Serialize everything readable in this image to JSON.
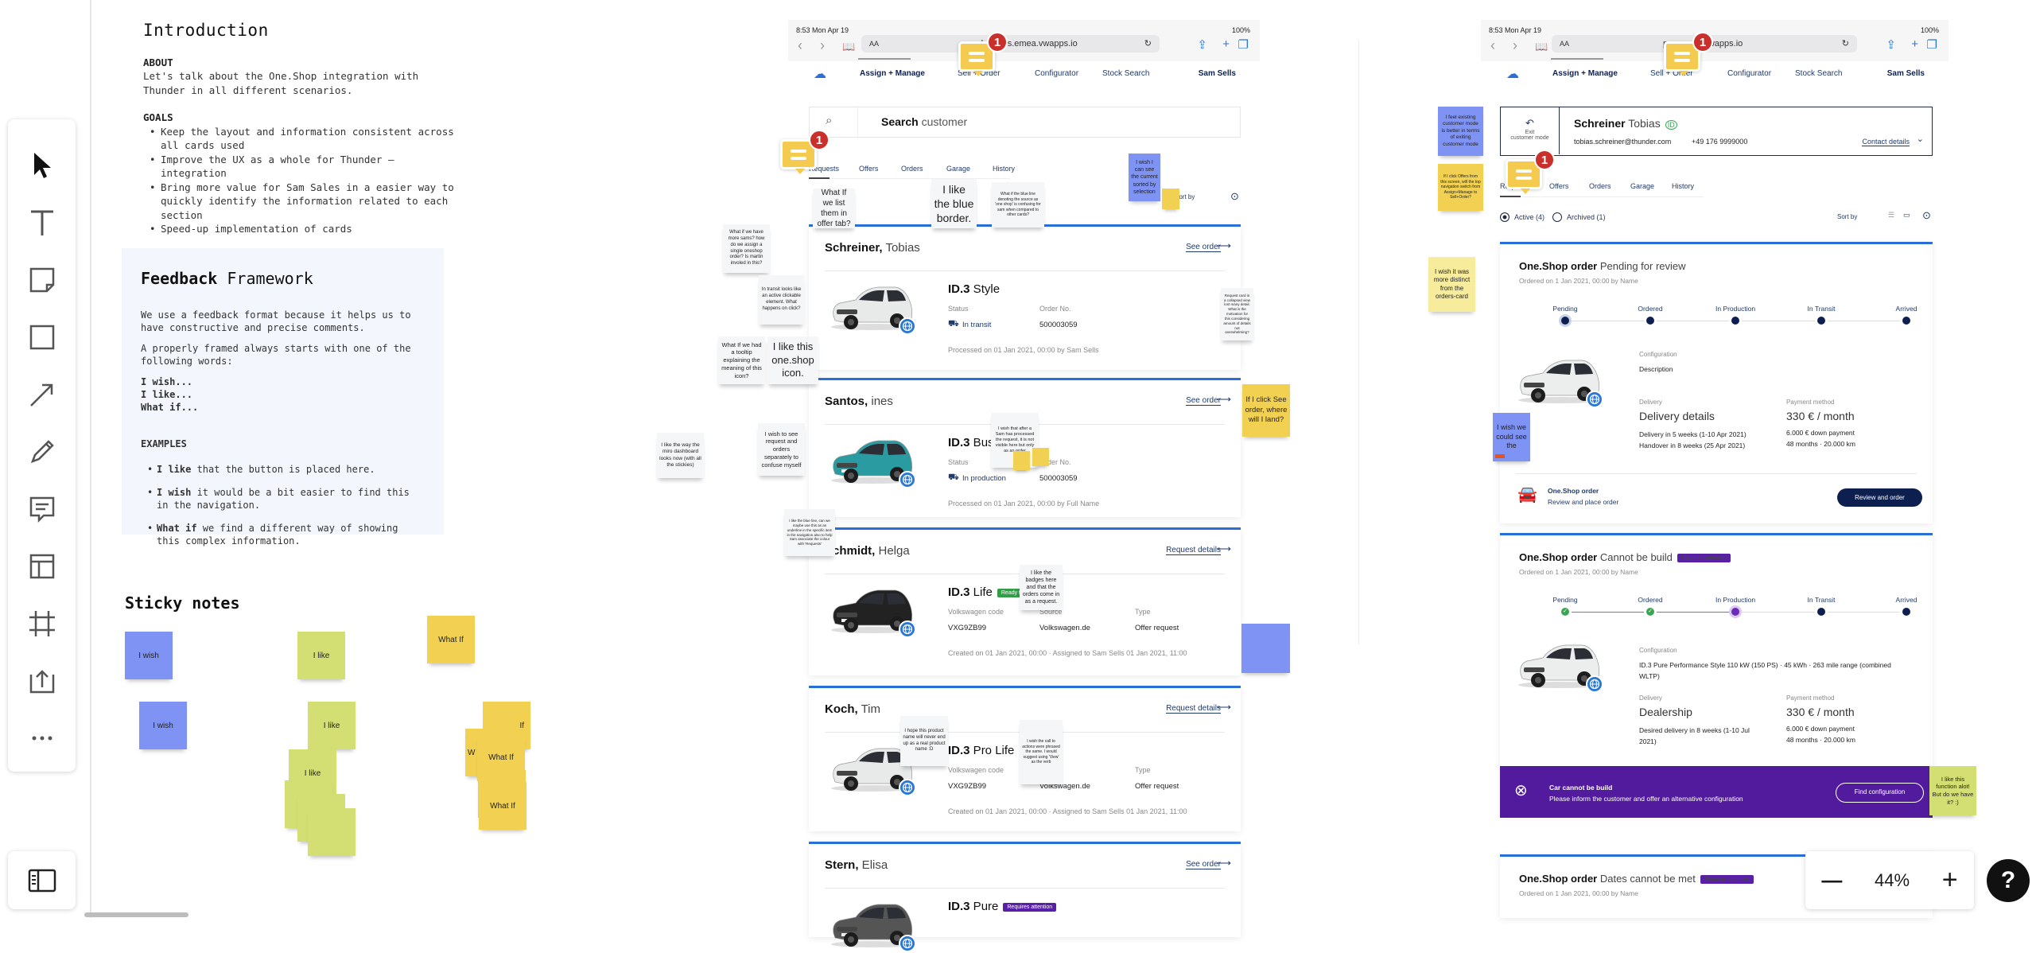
{
  "toolbar": {
    "tools": [
      "select",
      "text",
      "sticky-note",
      "shape",
      "arrow",
      "pen",
      "comment",
      "templates",
      "frame",
      "upload",
      "more"
    ]
  },
  "intro": {
    "title": "Introduction",
    "about_label": "ABOUT",
    "about_text": "Let's talk about the One.Shop integration with Thunder in all different scenarios.",
    "goals_label": "GOALS",
    "goals": [
      "Keep the layout and information consistent across all cards used",
      "Improve the UX as a whole for Thunder – integration",
      "Bring more value for Sam Sales in a easier way to quickly identify the information related to each section",
      "Speed-up implementation of cards"
    ]
  },
  "feedback": {
    "title_bold": "Feedback",
    "title_rest": " Framework",
    "p1": "We use a feedback format because it helps us to have constructive and precise comments.",
    "p2": "A properly framed always starts with one of the following words:",
    "words": [
      "I wish...",
      "I like...",
      "What if..."
    ],
    "examples_label": "EXAMPLES",
    "examples": [
      {
        "bold": "I like",
        "rest": " that the button is placed here."
      },
      {
        "bold": "I wish",
        "rest": " it would be a bit easier to find this in the navigation."
      },
      {
        "bold": "What if",
        "rest": " we find a different way of showing this complex information."
      }
    ]
  },
  "sticky_section": {
    "title": "Sticky notes",
    "notes": [
      {
        "text": "I wish",
        "color": "blue"
      },
      {
        "text": "I wish",
        "color": "blue"
      },
      {
        "text": "I like",
        "color": "green"
      },
      {
        "text": "I like",
        "color": "green"
      },
      {
        "text": "I like",
        "color": "green"
      },
      {
        "text": "",
        "color": "green"
      },
      {
        "text": "I like",
        "color": "green"
      },
      {
        "text": "",
        "color": "green"
      },
      {
        "text": "What If",
        "color": "yellow"
      },
      {
        "text": "If",
        "color": "yellow"
      },
      {
        "text": "W",
        "color": "yellow"
      },
      {
        "text": "What If",
        "color": "yellow"
      },
      {
        "text": "",
        "color": "yellow"
      },
      {
        "text": "What If",
        "color": "yellow"
      }
    ]
  },
  "status_bar": {
    "time": "8:53  Mon Apr 19",
    "battery": "100%"
  },
  "nav": {
    "items": [
      "Assign + Manage",
      "Sell + Order",
      "Configurator",
      "Stock Search"
    ],
    "user": "Sam Sells"
  },
  "phone1": {
    "url_prefix": "AA",
    "url": "der.apps.emea.vwapps.io",
    "search_bold": "Search",
    "search_rest": " customer",
    "tabs": [
      "Requests",
      "Offers",
      "Orders",
      "Garage",
      "History"
    ],
    "sort": "Sort by",
    "cards": [
      {
        "last": "Schreiner,",
        "first": " Tobias",
        "link": "See order",
        "model": "ID.3",
        "trim": " Style",
        "badge": "",
        "car_color": "#e8eaea",
        "fields": [
          {
            "label": "Status",
            "value": "In transit",
            "icon": "truck-icon"
          },
          {
            "label": "Order No.",
            "value": "500003059"
          }
        ],
        "footer": "Processed on 01 Jan 2021, 00:00 by Sam Sells"
      },
      {
        "last": "Santos,",
        "first": " ines",
        "link": "See order",
        "model": "ID.3",
        "trim": " Bus",
        "badge": "",
        "car_color": "#2a9ba0",
        "fields": [
          {
            "label": "Status",
            "value": "In production",
            "icon": "truck-icon"
          },
          {
            "label": "Order No.",
            "value": "500003059"
          }
        ],
        "footer": "Processed on 01 Jan 2021, 00:00 by Full Name"
      },
      {
        "last": "Schmidt,",
        "first": " Helga",
        "link": "Request details",
        "model": "ID.3",
        "trim": " Life",
        "badge": "Ready to o",
        "badge_color": "#2f9e44",
        "car_color": "#222",
        "fields": [
          {
            "label": "Volkswagen code",
            "value": "VXG9ZB99"
          },
          {
            "label": "Source",
            "value": "Volkswagen.de"
          },
          {
            "label": "Type",
            "value": "Offer request"
          }
        ],
        "footer": "Created on 01 Jan 2021, 00:00  ·  Assigned to Sam Sells 01 Jan 2021, 11:00"
      },
      {
        "last": "Koch,",
        "first": " Tim",
        "link": "Request details",
        "model": "ID.3",
        "trim": " Pro Life",
        "badge": "",
        "car_color": "#e8eaea",
        "fields": [
          {
            "label": "Volkswagen code",
            "value": "VXG9ZB99"
          },
          {
            "label": "Source",
            "value": "Volkswagen.de"
          },
          {
            "label": "Type",
            "value": "Offer request"
          }
        ],
        "footer": "Created on 01 Jan 2021, 00:00  ·  Assigned to Sam Sells 01 Jan 2021, 11:00"
      },
      {
        "last": "Stern,",
        "first": " Elisa",
        "link": "See order",
        "model": "ID.3",
        "trim": " Pure",
        "badge": "Requires attention",
        "badge_color": "#5a1fa8",
        "car_color": "#555",
        "fields": [],
        "footer": ""
      }
    ]
  },
  "phone2": {
    "url_prefix": "AA",
    "url": "pps.emea.vwapps.io",
    "customer": {
      "exit": "Exit",
      "exit2": "customer mode",
      "last": "Schreiner",
      "first": " Tobias",
      "id": "ID",
      "email": "tobias.schreiner@thunder.com",
      "phone": "+49 176 9999000",
      "contact": "Contact details"
    },
    "tabs": [
      "Requests",
      "Offers",
      "Orders",
      "Garage",
      "History"
    ],
    "filters": [
      {
        "label": "Active (4)",
        "checked": true
      },
      {
        "label": "Archived (1)",
        "checked": false
      }
    ],
    "sort": "Sort by",
    "steps": [
      "Pending",
      "Ordered",
      "In Production",
      "In Transit",
      "Arrived"
    ],
    "orders": [
      {
        "title": "One.Shop order",
        "status": " Pending for review",
        "badge": "",
        "subtitle": "Ordered on 1 Jan 2021, 00:00 by Name",
        "step_state": [
          "current",
          "todo",
          "todo",
          "todo",
          "todo"
        ],
        "config_label": "Configuration",
        "config": "Description",
        "delivery_label": "Delivery",
        "delivery": "Delivery details",
        "delivery_lines": [
          "Delivery in 5 weeks (1-10 Apr 2021)",
          "Handover in 8 weeks (25 Apr 2021)"
        ],
        "payment_label": "Payment method",
        "payment": "330 € / month",
        "payment_lines": [
          "6.000 € down payment",
          "48 months  · 20.000 km"
        ],
        "footer_title": "One.Shop order",
        "footer_sub": "Review and place order",
        "button": "Review and order"
      },
      {
        "title": "One.Shop order",
        "status": " Cannot be build",
        "badge": "Requires attention",
        "subtitle": "Ordered on 1 Jan 2021, 00:00 by Name",
        "step_state": [
          "done",
          "done",
          "current",
          "todo",
          "todo"
        ],
        "config_label": "Configuration",
        "config": "ID.3 Pure Performance Style 110 kW (150 PS)  ·  45 kWh  ·  263 mile range (combined WLTP)",
        "delivery_label": "Delivery",
        "delivery": "Dealership",
        "delivery_lines": [
          "Desired delivery in 8 weeks (1-10 Jul 2021)"
        ],
        "payment_label": "Payment method",
        "payment": "330 €  / month",
        "payment_lines": [
          "6.000 € down payment",
          "48 months  · 20.000 km"
        ],
        "footer_title": "Car cannot be build",
        "footer_sub": "Please inform the customer and offer an alternative configuration",
        "button": "Find configuration"
      },
      {
        "title": "One.Shop order",
        "status": " Dates cannot be met",
        "badge": "Requires attention",
        "subtitle": "Ordered on 1 Jan 2021, 00:00 by Name"
      }
    ]
  },
  "comments": [
    {
      "count": "1"
    },
    {
      "count": "1"
    },
    {
      "count": "1"
    },
    {
      "count": "1"
    }
  ],
  "stickies": [
    {
      "text": "What If we list them in offer tab?",
      "color": "gray"
    },
    {
      "text": "I like the blue border.",
      "color": "gray"
    },
    {
      "text": "What if the blue line denoting the source as 'one shop' is confusing for sam when compared to other cards?",
      "color": "gray"
    },
    {
      "text": "I wish I can see the current sorted by selection",
      "color": "blue"
    },
    {
      "text": "",
      "color": "yellow"
    },
    {
      "text": "What if we have more sams? how do we assign a single oneshop order? Is martin involed in this?",
      "color": "gray"
    },
    {
      "text": "In transit looks like an active clickable element. What happens on click?",
      "color": "gray"
    },
    {
      "text": "What If we had a tooltip explaining the meaning of this icon?",
      "color": "gray"
    },
    {
      "text": "I like this one.shop icon.",
      "color": "gray"
    },
    {
      "text": "Request card in a collapsed view lost many detail. What is the motivation for this considering amount of details not overwhelming?",
      "color": "gray"
    },
    {
      "text": "If I click See order, where will I land?",
      "color": "yellow"
    },
    {
      "text": "I wish that after a Sam has processed the request, it is not visible here but only as an order",
      "color": "gray"
    },
    {
      "text": "",
      "color": "yellow"
    },
    {
      "text": "",
      "color": "yellow"
    },
    {
      "text": "I wish to see request and orders separately to confuse myself",
      "color": "gray"
    },
    {
      "text": "I like the way the miro dashboard looks now (with all the stickies)",
      "color": "gray"
    },
    {
      "text": "I like the blue line, can we maybe use this as an underline in the specific item in the navigation also to help Sam associate the colour with 'Requests'",
      "color": "gray"
    },
    {
      "text": "I like the badges here and that the orders come in as a request.",
      "color": "gray"
    },
    {
      "text": "",
      "color": "blue"
    },
    {
      "text": "I hope this product name will never end up as a real product name :D",
      "color": "gray"
    },
    {
      "text": "I wish the call to actions were phrased the same. I would suggest using 'View' as the verb",
      "color": "gray"
    },
    {
      "text": "I feel existing customer mode is better in terms of exiting customer mode",
      "color": "blue"
    },
    {
      "text": "If I click Offers from this screen, will the top navigation switch from Assign+Manage to Sell+Order?",
      "color": "yellow"
    },
    {
      "text": "I wish it was more distinct from the orders-card",
      "color": "pale"
    },
    {
      "text": "I wish we could see the",
      "color": "blue"
    },
    {
      "text": "I like this function alot! But do we have it? :)",
      "color": "green"
    }
  ],
  "zoom": {
    "minus": "—",
    "value": "44%",
    "plus": "+"
  },
  "help": "?",
  "colors": {
    "accent_blue": "#2a6ed8",
    "navy": "#0d1f4f",
    "purple": "#521b9e",
    "comment_badge": "#c9302c"
  }
}
